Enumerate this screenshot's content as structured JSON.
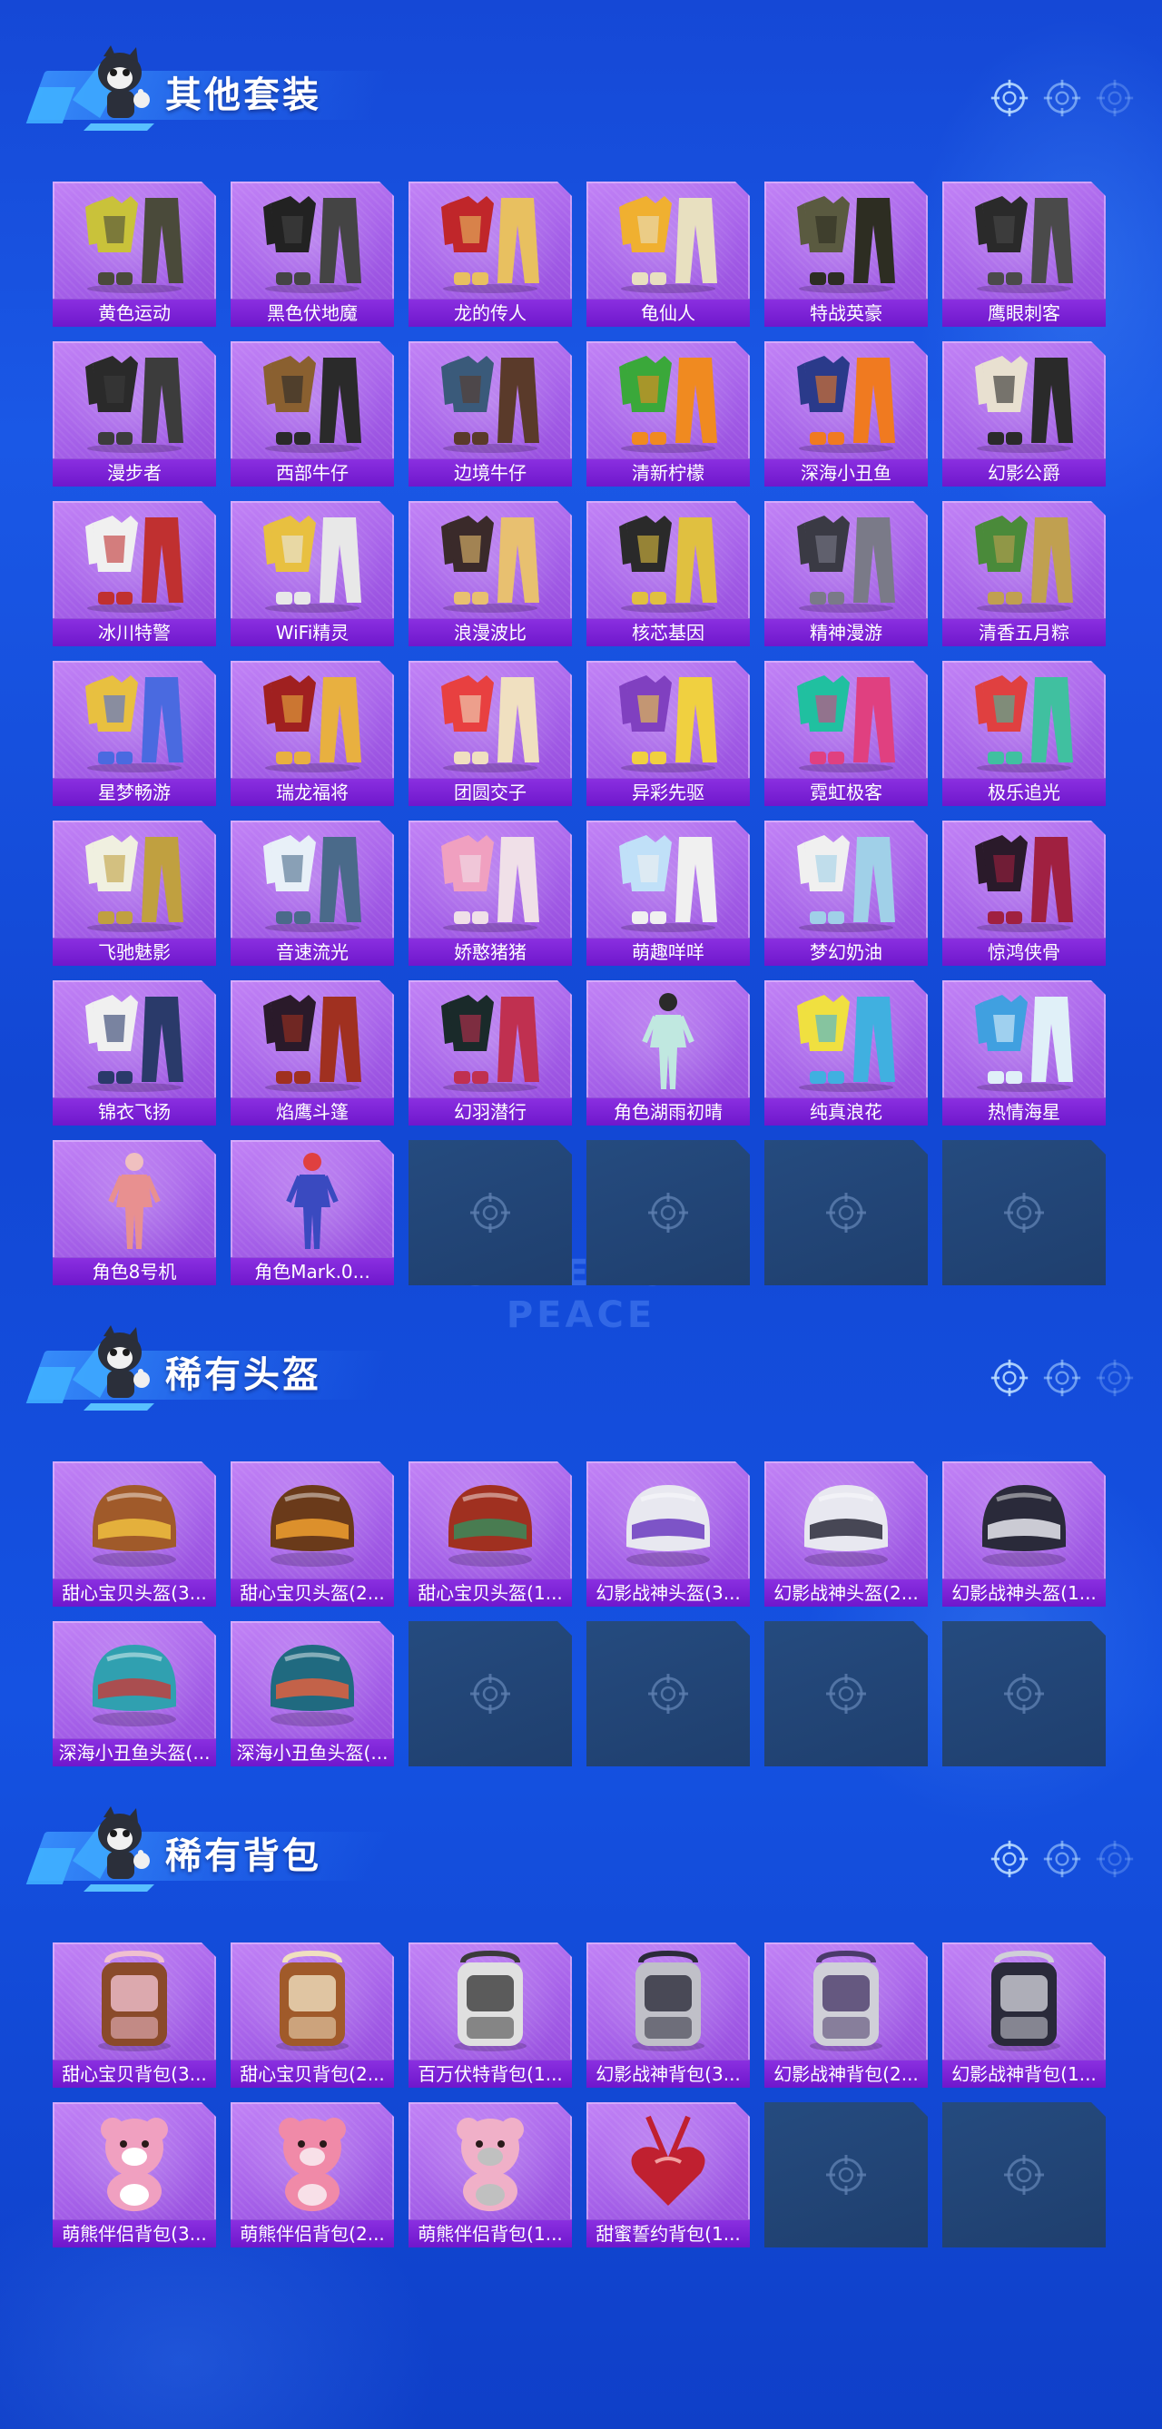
{
  "sections": [
    {
      "title": "其他套装",
      "items": [
        {
          "label": "黄色运动",
          "kind": "suit",
          "colors": [
            "#c9c23a",
            "#4a4a3a"
          ]
        },
        {
          "label": "黑色伏地魔",
          "kind": "suit",
          "colors": [
            "#222222",
            "#444444"
          ]
        },
        {
          "label": "龙的传人",
          "kind": "suit",
          "colors": [
            "#c0262a",
            "#e8c060"
          ]
        },
        {
          "label": "龟仙人",
          "kind": "suit",
          "colors": [
            "#f0b030",
            "#e8e0c0"
          ]
        },
        {
          "label": "特战英豪",
          "kind": "suit",
          "colors": [
            "#5a5a40",
            "#2d2d22"
          ]
        },
        {
          "label": "鹰眼刺客",
          "kind": "suit",
          "colors": [
            "#2a2a2a",
            "#4a4a4a"
          ]
        },
        {
          "label": "漫步者",
          "kind": "suit",
          "colors": [
            "#2a2a2a",
            "#3c3c3c"
          ]
        },
        {
          "label": "西部牛仔",
          "kind": "suit",
          "colors": [
            "#8a6030",
            "#2a2a2a"
          ]
        },
        {
          "label": "边境牛仔",
          "kind": "suit",
          "colors": [
            "#3a5a7a",
            "#5a3a2a"
          ]
        },
        {
          "label": "清新柠檬",
          "kind": "suit",
          "colors": [
            "#3aa83a",
            "#f08a20"
          ]
        },
        {
          "label": "深海小丑鱼",
          "kind": "suit",
          "colors": [
            "#2a3a8a",
            "#f07a20"
          ]
        },
        {
          "label": "幻影公爵",
          "kind": "suit",
          "colors": [
            "#e8e0d0",
            "#2a2a2a"
          ]
        },
        {
          "label": "冰川特警",
          "kind": "suit",
          "colors": [
            "#f0f0f0",
            "#c03030"
          ]
        },
        {
          "label": "WiFi精灵",
          "kind": "suit",
          "colors": [
            "#e8c040",
            "#e8e8e8"
          ]
        },
        {
          "label": "浪漫波比",
          "kind": "suit",
          "colors": [
            "#3a2a2a",
            "#e8c070"
          ]
        },
        {
          "label": "核芯基因",
          "kind": "suit",
          "colors": [
            "#2a2a2a",
            "#e0c040"
          ]
        },
        {
          "label": "精神漫游",
          "kind": "suit",
          "colors": [
            "#3a3a44",
            "#7a7a88"
          ]
        },
        {
          "label": "清香五月粽",
          "kind": "suit",
          "colors": [
            "#4a8a3a",
            "#c0a050"
          ]
        },
        {
          "label": "星梦畅游",
          "kind": "suit",
          "colors": [
            "#e8c040",
            "#4a6ae0"
          ]
        },
        {
          "label": "瑞龙福将",
          "kind": "suit",
          "colors": [
            "#a02020",
            "#e8b040"
          ]
        },
        {
          "label": "团圆交子",
          "kind": "suit",
          "colors": [
            "#e84040",
            "#f0e0c0"
          ]
        },
        {
          "label": "异彩先驱",
          "kind": "suit",
          "colors": [
            "#8040c0",
            "#f0d040"
          ]
        },
        {
          "label": "霓虹极客",
          "kind": "suit",
          "colors": [
            "#20c0a0",
            "#e04080"
          ]
        },
        {
          "label": "极乐追光",
          "kind": "suit",
          "colors": [
            "#e04040",
            "#40c0a0"
          ]
        },
        {
          "label": "飞驰魅影",
          "kind": "suit",
          "colors": [
            "#f0f0e0",
            "#c0a040"
          ]
        },
        {
          "label": "音速流光",
          "kind": "suit",
          "colors": [
            "#e8f0f8",
            "#4a6a8a"
          ]
        },
        {
          "label": "娇憨猪猪",
          "kind": "suit",
          "colors": [
            "#f0a0c0",
            "#f0e0e8"
          ]
        },
        {
          "label": "萌趣咩咩",
          "kind": "suit",
          "colors": [
            "#c0e0f8",
            "#f0f0f0"
          ]
        },
        {
          "label": "梦幻奶油",
          "kind": "suit",
          "colors": [
            "#f0f0f0",
            "#a0d0e8"
          ]
        },
        {
          "label": "惊鸿侠骨",
          "kind": "suit",
          "colors": [
            "#2a1a2a",
            "#a02040"
          ]
        },
        {
          "label": "锦衣飞扬",
          "kind": "suit",
          "colors": [
            "#f0f0f0",
            "#2a3a6a"
          ]
        },
        {
          "label": "焰鹰斗篷",
          "kind": "suit",
          "colors": [
            "#2a1a2a",
            "#a03020"
          ]
        },
        {
          "label": "幻羽潜行",
          "kind": "suit",
          "colors": [
            "#1a2a2a",
            "#c03050"
          ]
        },
        {
          "label": "角色湖雨初晴",
          "kind": "figure",
          "colors": [
            "#c0e8e0",
            "#2a2a2a"
          ]
        },
        {
          "label": "纯真浪花",
          "kind": "suit",
          "colors": [
            "#f0e040",
            "#40b0e0"
          ]
        },
        {
          "label": "热情海星",
          "kind": "suit",
          "colors": [
            "#40a0e0",
            "#e0f0f8"
          ]
        },
        {
          "label": "角色8号机",
          "kind": "figure",
          "colors": [
            "#e89090",
            "#f0c0c0"
          ]
        },
        {
          "label": "角色Mark.0...",
          "kind": "figure",
          "colors": [
            "#3a4ac0",
            "#e04040"
          ]
        },
        {
          "empty": true
        },
        {
          "empty": true
        },
        {
          "empty": true
        },
        {
          "empty": true
        }
      ]
    },
    {
      "title": "稀有头盔",
      "items": [
        {
          "label": "甜心宝贝头盔(3...",
          "kind": "helmet",
          "colors": [
            "#a05a2a",
            "#f0c040"
          ]
        },
        {
          "label": "甜心宝贝头盔(2...",
          "kind": "helmet",
          "colors": [
            "#6a3a1a",
            "#f0a030"
          ]
        },
        {
          "label": "甜心宝贝头盔(1...",
          "kind": "helmet",
          "colors": [
            "#a03020",
            "#3a8a5a"
          ]
        },
        {
          "label": "幻影战神头盔(3...",
          "kind": "helmet",
          "colors": [
            "#e8e8f0",
            "#6a3ac0"
          ]
        },
        {
          "label": "幻影战神头盔(2...",
          "kind": "helmet",
          "colors": [
            "#e8e8f0",
            "#2a2a3a"
          ]
        },
        {
          "label": "幻影战神头盔(1...",
          "kind": "helmet",
          "colors": [
            "#2a2a3a",
            "#e8e8f0"
          ]
        },
        {
          "label": "深海小丑鱼头盔(...",
          "kind": "helmet",
          "colors": [
            "#30a0b0",
            "#c04040"
          ]
        },
        {
          "label": "深海小丑鱼头盔(...",
          "kind": "helmet",
          "colors": [
            "#206a80",
            "#e06040"
          ]
        },
        {
          "empty": true
        },
        {
          "empty": true
        },
        {
          "empty": true
        },
        {
          "empty": true
        }
      ]
    },
    {
      "title": "稀有背包",
      "items": [
        {
          "label": "甜心宝贝背包(3...",
          "kind": "backpack",
          "colors": [
            "#8a4a2a",
            "#f0c0d0"
          ]
        },
        {
          "label": "甜心宝贝背包(2...",
          "kind": "backpack",
          "colors": [
            "#a05a2a",
            "#f0e0c0"
          ]
        },
        {
          "label": "百万伏特背包(1...",
          "kind": "backpack",
          "colors": [
            "#e0e0e0",
            "#3a3a3a"
          ]
        },
        {
          "label": "幻影战神背包(3...",
          "kind": "backpack",
          "colors": [
            "#c0c0c8",
            "#2a2a3a"
          ]
        },
        {
          "label": "幻影战神背包(2...",
          "kind": "backpack",
          "colors": [
            "#d0d0d8",
            "#4a3a6a"
          ]
        },
        {
          "label": "幻影战神背包(1...",
          "kind": "backpack",
          "colors": [
            "#2a2a3a",
            "#d0d0d8"
          ]
        },
        {
          "label": "萌熊伴侣背包(3...",
          "kind": "bear",
          "colors": [
            "#f0a0c0",
            "#ffffff"
          ]
        },
        {
          "label": "萌熊伴侣背包(2...",
          "kind": "bear",
          "colors": [
            "#f08aa8",
            "#f8e0e8"
          ]
        },
        {
          "label": "萌熊伴侣背包(1...",
          "kind": "bear",
          "colors": [
            "#f0b0c8",
            "#c0c0c0"
          ]
        },
        {
          "label": "甜蜜誓约背包(1...",
          "kind": "heartbag",
          "colors": [
            "#c02030",
            "#f0a0a0"
          ]
        },
        {
          "empty": true
        },
        {
          "empty": true
        }
      ]
    }
  ],
  "watermark_text": "GAME FOR PEACE",
  "theme": {
    "accent": "#7a22d6",
    "card_purple": "#a45fe8",
    "empty_slot": "#244a7c",
    "background": "#1552e2"
  }
}
